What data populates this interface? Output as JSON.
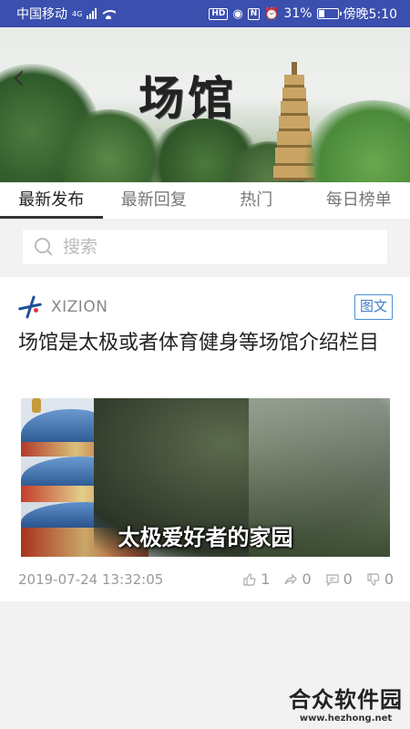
{
  "status_bar": {
    "carrier": "中国移动",
    "network": "4G",
    "hd": "HD",
    "nfc": "N",
    "battery_percent": 31,
    "battery_label": "31%",
    "time": "傍晚5:10"
  },
  "banner": {
    "title": "场馆"
  },
  "tabs": [
    {
      "label": "最新发布",
      "active": true
    },
    {
      "label": "最新回复",
      "active": false
    },
    {
      "label": "热门",
      "active": false
    },
    {
      "label": "每日榜单",
      "active": false
    }
  ],
  "search": {
    "placeholder": "搜索"
  },
  "post": {
    "source": "XIZION",
    "type_badge": "图文",
    "title": "场馆是太极或者体育健身等场馆介绍栏目",
    "image_caption": "太极爱好者的家园",
    "date": "2019-07-24 13:32:05",
    "likes": "1",
    "shares": "0",
    "comments": "0",
    "dislikes": "0"
  },
  "watermark": {
    "title": "合众软件园",
    "url": "www.hezhong.net"
  },
  "colors": {
    "status_bar": "#3a4fae",
    "badge_blue": "#3f7fc7"
  }
}
